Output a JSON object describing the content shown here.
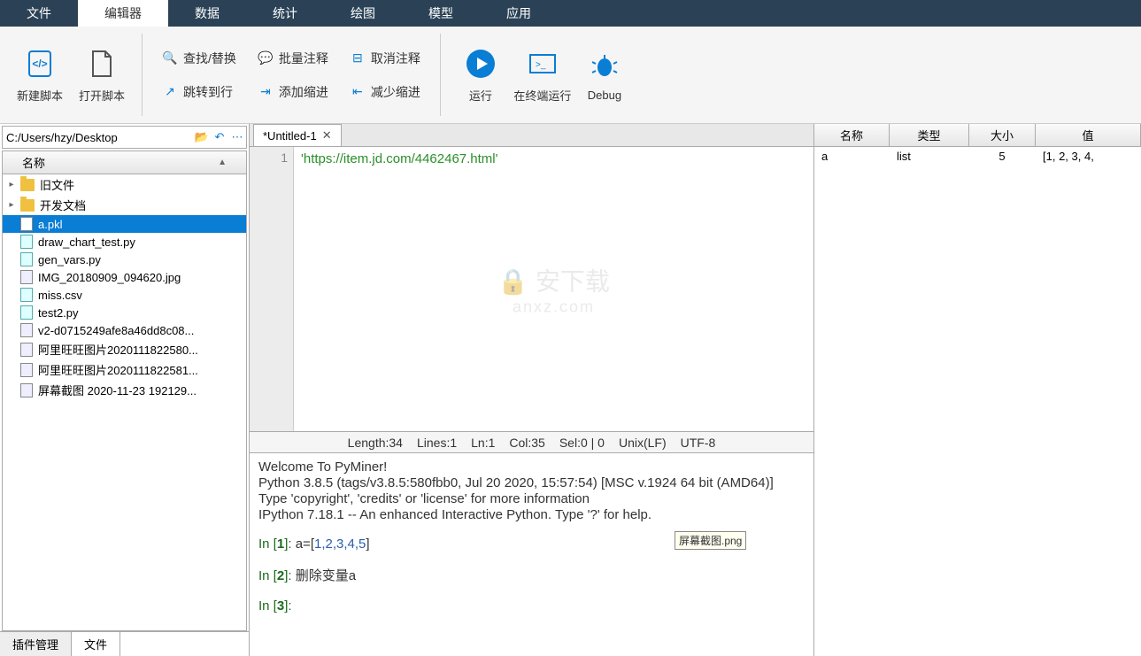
{
  "menu": {
    "tabs": [
      "文件",
      "编辑器",
      "数据",
      "统计",
      "绘图",
      "模型",
      "应用"
    ],
    "active_index": 1
  },
  "ribbon": {
    "new_script": "新建脚本",
    "open_script": "打开脚本",
    "find_replace": "查找/替换",
    "jump_to_line": "跳转到行",
    "batch_comment": "批量注释",
    "add_indent": "添加缩进",
    "cancel_comment": "取消注释",
    "reduce_indent": "减少缩进",
    "run": "运行",
    "run_in_terminal": "在终端运行",
    "debug": "Debug"
  },
  "path": "C:/Users/hzy/Desktop",
  "file_header": "名称",
  "files": [
    {
      "name": "旧文件",
      "type": "folder",
      "expand": true
    },
    {
      "name": "开发文档",
      "type": "folder",
      "expand": true
    },
    {
      "name": "a.pkl",
      "type": "file",
      "selected": true
    },
    {
      "name": "draw_chart_test.py",
      "type": "py"
    },
    {
      "name": "gen_vars.py",
      "type": "py"
    },
    {
      "name": "IMG_20180909_094620.jpg",
      "type": "img"
    },
    {
      "name": "miss.csv",
      "type": "py"
    },
    {
      "name": "test2.py",
      "type": "py"
    },
    {
      "name": "v2-d0715249afe8a46dd8c08...",
      "type": "img"
    },
    {
      "name": "阿里旺旺图片2020111822580...",
      "type": "img"
    },
    {
      "name": "阿里旺旺图片2020111822581...",
      "type": "img"
    },
    {
      "name": "屏幕截图 2020-11-23 192129...",
      "type": "img"
    }
  ],
  "bottom_tabs": {
    "plugin": "插件管理",
    "file": "文件",
    "active": "file"
  },
  "editor": {
    "tab_title": "*Untitled-1",
    "line_number": "1",
    "code_line": "'https://item.jd.com/4462467.html'",
    "watermark_main": "安下载",
    "watermark_sub": "anxz.com"
  },
  "status": {
    "length": "Length:34",
    "lines": "Lines:1",
    "ln": "Ln:1",
    "col": "Col:35",
    "sel": "Sel:0 | 0",
    "eol": "Unix(LF)",
    "enc": "UTF-8"
  },
  "console": {
    "welcome": "Welcome To PyMiner!",
    "python_ver": "Python 3.8.5 (tags/v3.8.5:580fbb0, Jul 20 2020, 15:57:54) [MSC v.1924 64 bit (AMD64)]",
    "type_info": "Type 'copyright', 'credits' or 'license' for more information",
    "ipython": "IPython 7.18.1 -- An enhanced Interactive Python. Type '?' for help.",
    "in1_label": "In [",
    "in1_num": "1",
    "in1_close": "]: ",
    "in1_code_a": "a=[",
    "in1_code_nums": "1,2,3,4,5",
    "in1_code_b": "]",
    "in2_num": "2",
    "in2_code": "删除变量a",
    "in3_num": "3",
    "tooltip": "屏幕截图.png"
  },
  "vars": {
    "headers": {
      "name": "名称",
      "type": "类型",
      "size": "大小",
      "value": "值"
    },
    "rows": [
      {
        "name": "a",
        "type": "list",
        "size": "5",
        "value": "[1, 2, 3, 4,"
      }
    ]
  }
}
